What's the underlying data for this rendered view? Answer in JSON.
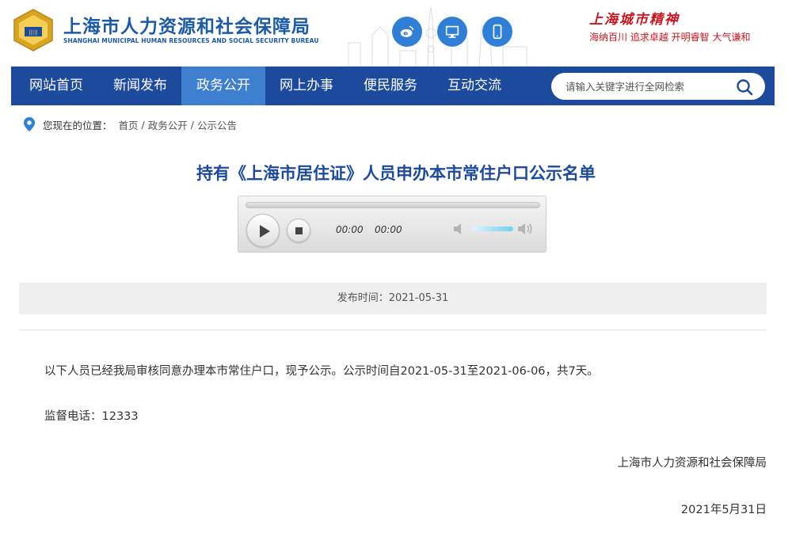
{
  "header": {
    "title": "上海市人力资源和社会保障局",
    "subtitle": "SHANGHAI MUNICIPAL HUMAN RESOURCES AND SOCIAL SECURITY BUREAU",
    "spirit_title": "上海城市精神",
    "spirit_motto": "海纳百川 追求卓越 开明睿智 大气谦和",
    "social_icons": [
      "weibo-icon",
      "monitor-icon",
      "mobile-icon"
    ]
  },
  "nav": {
    "items": [
      "网站首页",
      "新闻发布",
      "政务公开",
      "网上办事",
      "便民服务",
      "互动交流"
    ],
    "active_index": 2
  },
  "search": {
    "placeholder": "请输入关键字进行全网检索"
  },
  "breadcrumb": {
    "prefix": "您现在的位置：",
    "items": [
      "首页",
      "政务公开",
      "公示公告"
    ]
  },
  "article": {
    "title": "持有《上海市居住证》人员申办本市常住户口公示名单",
    "publish_label": "发布时间：2021-05-31",
    "body": [
      "以下人员已经我局审核同意办理本市常住户口，现予公示。公示时间自2021-05-31至2021-06-06，共7天。",
      "监督电话：12333"
    ],
    "signature": "上海市人力资源和社会保障局",
    "date": "2021年5月31日"
  },
  "player": {
    "current_time": "00:00",
    "duration": "00:00",
    "progress": 0,
    "volume_level": 0.8
  },
  "colors": {
    "brand_blue": "#1c4a9c",
    "active_nav": "#3f7fd0",
    "title_blue": "#1a5aa8",
    "spirit_red": "#c9161e"
  }
}
